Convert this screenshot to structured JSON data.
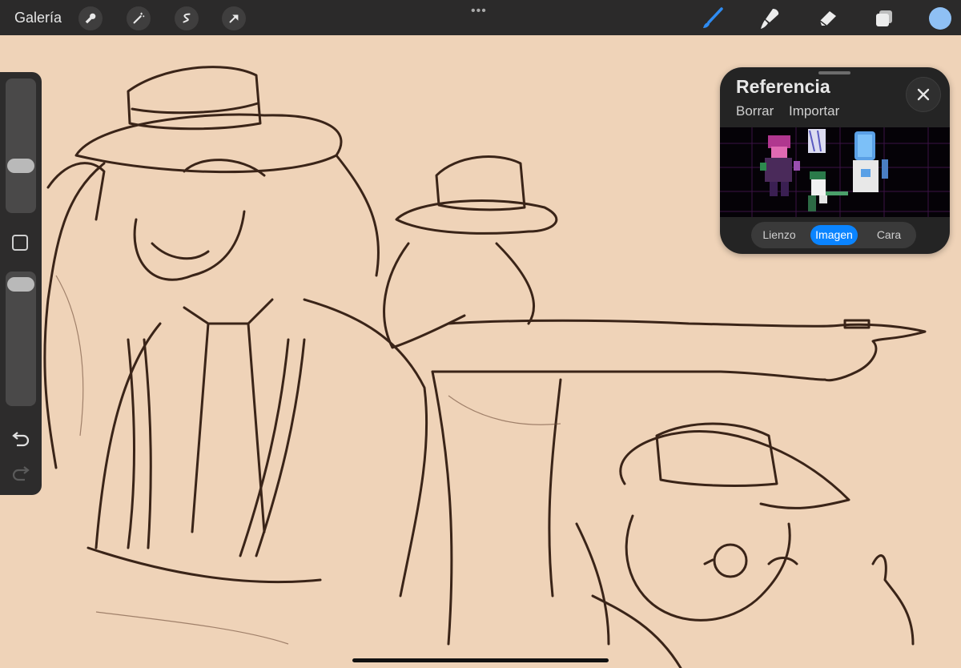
{
  "topbar": {
    "gallery_label": "Galería",
    "left_tools": [
      "wrench-icon",
      "magic-wand-icon",
      "selection-icon",
      "transform-arrow-icon"
    ],
    "more_dots": "•••",
    "right_tools": [
      "brush-icon",
      "smudge-icon",
      "eraser-icon",
      "layers-icon"
    ],
    "current_color": "#8fc0f4"
  },
  "sidebar": {
    "undo": "undo-icon",
    "redo": "redo-icon"
  },
  "reference": {
    "title": "Referencia",
    "clear_label": "Borrar",
    "import_label": "Importar",
    "close_icon": "close-icon",
    "modes": [
      {
        "label": "Lienzo",
        "active": false
      },
      {
        "label": "Imagen",
        "active": true
      },
      {
        "label": "Cara",
        "active": false
      }
    ]
  },
  "colors": {
    "canvas_bg": "#efd3b8",
    "toolbar_bg": "#2b2a2a",
    "accent": "#0a84ff",
    "line_art": "#3a2418"
  }
}
